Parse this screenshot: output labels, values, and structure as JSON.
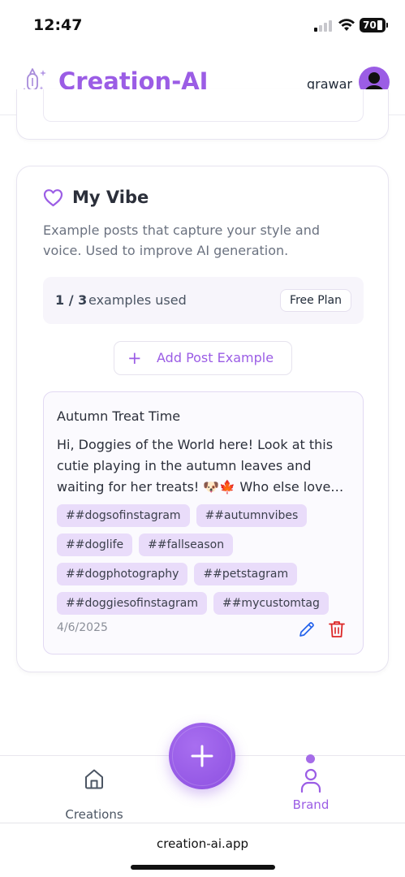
{
  "status_bar": {
    "time": "12:47",
    "battery": "70"
  },
  "header": {
    "app_name": "Creation-AI",
    "username": "grawar",
    "logo_icon": "sparkle-pen-icon",
    "avatar_icon": "user-avatar-icon"
  },
  "vibe_section": {
    "title": "My Vibe",
    "icon": "heart-icon",
    "description": "Example posts that capture your style and voice. Used to improve AI generation.",
    "usage": {
      "count": "1 / 3",
      "label": "examples used",
      "plan": "Free Plan"
    },
    "add_button_label": "Add Post Example",
    "examples": [
      {
        "title": "Autumn Treat Time",
        "body": "Hi, Doggies of the World here! Look at this cutie playing in the autumn leaves and waiting for her treats! 🐶🍁 Who else love…",
        "tags": [
          "##dogsofinstagram",
          "##autumnvibes",
          "##doglife",
          "##fallseason",
          "##dogphotography",
          "##petstagram",
          "##doggiesofinstagram",
          "##mycustomtag"
        ],
        "date": "4/6/2025"
      }
    ]
  },
  "bottom_nav": {
    "items": [
      {
        "label": "Creations",
        "icon": "home-icon",
        "active": false
      },
      {
        "label": "Brand",
        "icon": "user-icon",
        "active": true
      }
    ],
    "fab_icon": "plus-icon"
  },
  "browser": {
    "url": "creation-ai.app"
  },
  "colors": {
    "accent": "#9b5de5",
    "tag_bg": "#e9dcfa",
    "edit_icon": "#2563eb",
    "delete_icon": "#dc2626"
  }
}
